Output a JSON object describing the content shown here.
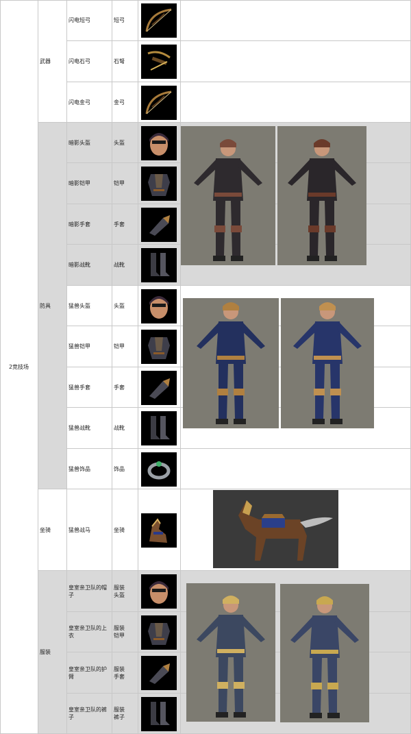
{
  "section": "2竞技场",
  "categories": {
    "weapons": "武器",
    "armor": "防具",
    "mount": "坐骑",
    "costume": "服装"
  },
  "items": [
    {
      "name": "闪电短弓",
      "type": "短弓",
      "icon": "bow-icon"
    },
    {
      "name": "闪电石弓",
      "type": "石弩",
      "icon": "crossbow-icon"
    },
    {
      "name": "闪电金弓",
      "type": "金弓",
      "icon": "bow-icon"
    },
    {
      "name": "暗影头盔",
      "type": "头盔",
      "icon": "helmet-icon"
    },
    {
      "name": "暗影铠甲",
      "type": "铠甲",
      "icon": "armor-icon"
    },
    {
      "name": "暗影手套",
      "type": "手套",
      "icon": "glove-icon"
    },
    {
      "name": "暗影战靴",
      "type": "战靴",
      "icon": "boots-icon"
    },
    {
      "name": "猛兽头盔",
      "type": "头盔",
      "icon": "helmet-icon"
    },
    {
      "name": "猛兽铠甲",
      "type": "铠甲",
      "icon": "armor-icon"
    },
    {
      "name": "猛兽手套",
      "type": "手套",
      "icon": "glove-icon"
    },
    {
      "name": "猛兽战靴",
      "type": "战靴",
      "icon": "boots-icon"
    },
    {
      "name": "猛兽饰品",
      "type": "饰品",
      "icon": "ring-icon"
    },
    {
      "name": "猛兽战马",
      "type": "坐骑",
      "icon": "horse-icon"
    },
    {
      "name": "皇室亲卫队的帽子",
      "type_lines": [
        "服装",
        "头盔"
      ],
      "icon": "helmet-icon"
    },
    {
      "name": "皇室亲卫队的上衣",
      "type_lines": [
        "服装",
        "铠甲"
      ],
      "icon": "armor-icon"
    },
    {
      "name": "皇室亲卫队的护臂",
      "type_lines": [
        "服装",
        "手套"
      ],
      "icon": "glove-icon"
    },
    {
      "name": "皇室亲卫队的裤子",
      "type_lines": [
        "服装",
        "裤子"
      ],
      "icon": "boots-icon"
    }
  ],
  "colors": {
    "grey_band": "#d9d9d9",
    "border": "#c8c8c8",
    "preview_bg": "#7d7b72",
    "mount_bg": "#3a3a3a",
    "thumb_bg": "#000000"
  }
}
